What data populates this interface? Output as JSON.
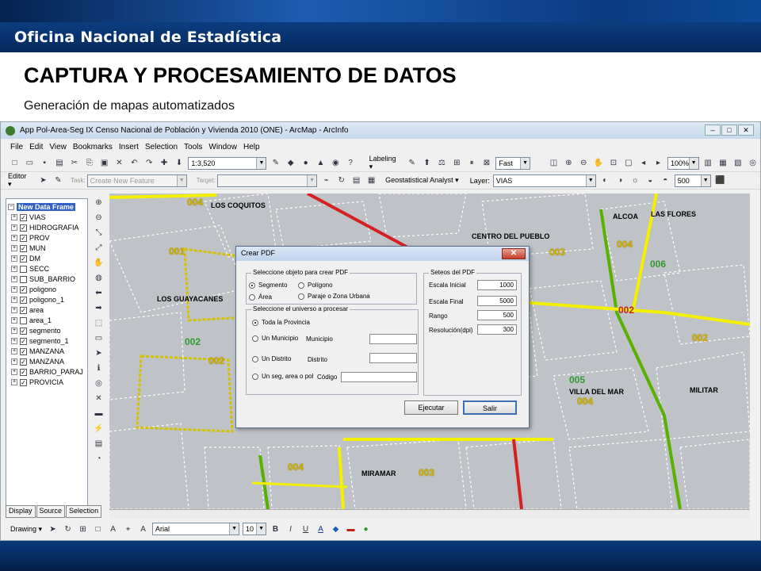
{
  "org_name": "Oficina Nacional de Estadística",
  "slide_title": "CAPTURA Y PROCESAMIENTO DE DATOS",
  "slide_subtitle": "Generación de mapas automatizados",
  "window": {
    "title": "App Pol-Area-Seg IX Censo Nacional de Población y Vivienda 2010 (ONE) - ArcMap - ArcInfo",
    "min": "‒",
    "max": "□",
    "close": "✕"
  },
  "menu": [
    "File",
    "Edit",
    "View",
    "Bookmarks",
    "Insert",
    "Selection",
    "Tools",
    "Window",
    "Help"
  ],
  "toolbar1": {
    "scale": "1:3,520",
    "labeling": "Labeling ▾",
    "speed": "Fast",
    "zoom": "100%"
  },
  "toolbar2": {
    "editor": "Editor ▾",
    "task_label": "Task:",
    "task_value": "Create New Feature",
    "target_label": "Target:",
    "geostat": "Geostatistical Analyst ▾",
    "layer_label": "Layer:",
    "layer_value": "VIAS",
    "size_value": "500"
  },
  "toc": {
    "frame": "New Data Frame",
    "layers": [
      {
        "name": "VIAS",
        "checked": true
      },
      {
        "name": "HIDROGRAFIA",
        "checked": true
      },
      {
        "name": "PROV",
        "checked": true
      },
      {
        "name": "MUN",
        "checked": true
      },
      {
        "name": "DM",
        "checked": true
      },
      {
        "name": "SECC",
        "checked": false
      },
      {
        "name": "SUB_BARRIO",
        "checked": false
      },
      {
        "name": "poligono",
        "checked": true
      },
      {
        "name": "poligono_1",
        "checked": true
      },
      {
        "name": "area",
        "checked": true
      },
      {
        "name": "area_1",
        "checked": false
      },
      {
        "name": "segmento",
        "checked": true
      },
      {
        "name": "segmento_1",
        "checked": true
      },
      {
        "name": "MANZANA",
        "checked": true
      },
      {
        "name": "MANZANA",
        "checked": true
      },
      {
        "name": "BARRIO_PARAJ",
        "checked": true
      },
      {
        "name": "PROVICIA",
        "checked": true
      }
    ],
    "tabs": [
      "Display",
      "Source",
      "Selection"
    ]
  },
  "map_labels": {
    "coquitos": "LOS COQUITOS",
    "guayacanes": "LOS GUAYACANES",
    "centro": "CENTRO DEL PUEBLO",
    "alcoa": "ALCOA",
    "flores": "LAS FLORES",
    "villa": "VILLA DEL MAR",
    "militar": "MILITAR",
    "miramar": "MIRAMAR",
    "n004a": "004",
    "n001": "001",
    "n002a": "002",
    "n002b": "002",
    "n003a": "003",
    "n004b": "004",
    "n006": "006",
    "n002r": "002",
    "n002c": "002",
    "n005": "005",
    "n004c": "004",
    "n004d": "004",
    "n003b": "003"
  },
  "dialog": {
    "title": "Crear PDF",
    "close": "✕",
    "group1_title": "Seleccione objeto para crear PDF",
    "opt_segmento": "Segmento",
    "opt_poligono": "Polígono",
    "opt_area": "Área",
    "opt_paraje": "Paraje o Zona Urbana",
    "group2_title": "Seleccione el universo a procesar",
    "opt_provincia": "Toda la Provincia",
    "opt_municipio": "Un Municipio",
    "lbl_municipio": "Municipio",
    "opt_distrito": "Un Distrito",
    "lbl_distrito": "Distrito",
    "opt_seg": "Un seg, area o pol",
    "lbl_codigo": "Código",
    "group3_title": "Seteos del PDF",
    "escala_inicial_label": "Escala Inicial",
    "escala_inicial": "1000",
    "escala_final_label": "Escala Final",
    "escala_final": "5000",
    "rango_label": "Rango",
    "rango": "500",
    "resolucion_label": "Resolución(dpi)",
    "resolucion": "300",
    "btn_ejecutar": "Ejecutar",
    "btn_salir": "Salir"
  },
  "drawbar": {
    "drawing": "Drawing ▾",
    "font": "Arial",
    "size": "10",
    "bold": "B",
    "italic": "I",
    "underline": "U"
  }
}
